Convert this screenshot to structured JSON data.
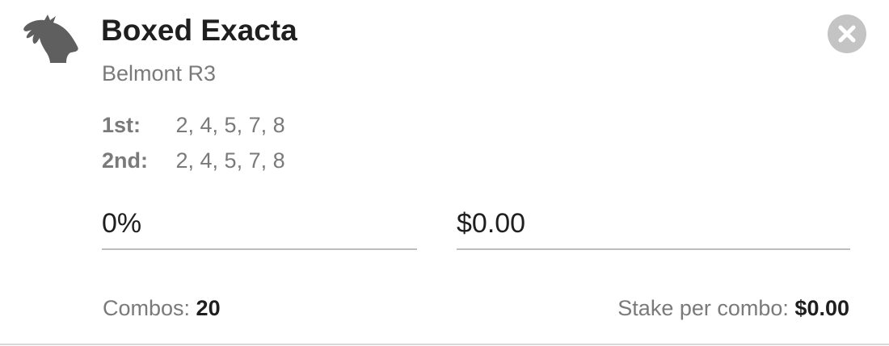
{
  "bet": {
    "icon": "horse-head-icon",
    "title": "Boxed Exacta",
    "race": "Belmont R3",
    "close_icon": "close-icon"
  },
  "selections": [
    {
      "label": "1st:",
      "values": "2, 4, 5, 7, 8"
    },
    {
      "label": "2nd:",
      "values": "2, 4, 5, 7, 8"
    }
  ],
  "inputs": {
    "percent_value": "0%",
    "amount_value": "$0.00"
  },
  "footer": {
    "combos_label": "Combos: ",
    "combos_value": "20",
    "stake_label": "Stake per combo: ",
    "stake_value": "$0.00"
  },
  "colors": {
    "icon": "#5f5f5f",
    "close_bg": "#c4c4c4",
    "primary_text": "#1f1f1f",
    "secondary_text": "#7a7a7a",
    "underline": "#bdbdbd"
  }
}
